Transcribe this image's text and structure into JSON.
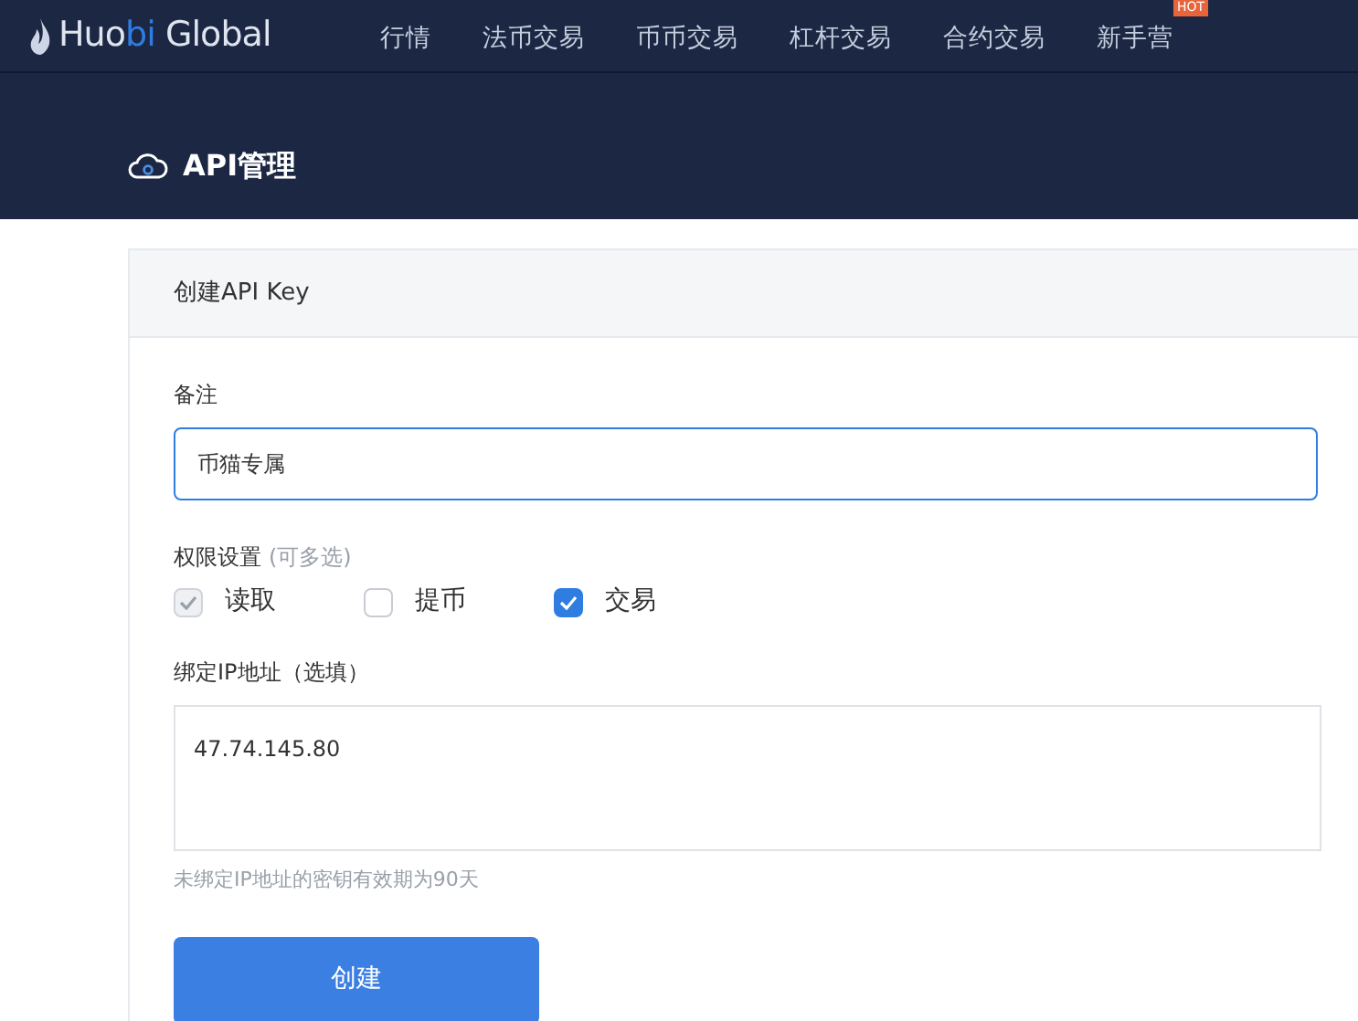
{
  "logo": {
    "before": "Huo",
    "accent": "bi",
    "after": " Global"
  },
  "nav": [
    {
      "label": "行情"
    },
    {
      "label": "法币交易"
    },
    {
      "label": "币币交易"
    },
    {
      "label": "杠杆交易"
    },
    {
      "label": "合约交易"
    },
    {
      "label": "新手营",
      "badge": "HOT"
    }
  ],
  "page_title": "API管理",
  "card": {
    "title": "创建API Key",
    "note": {
      "label": "备注",
      "value": "币猫专属"
    },
    "permissions": {
      "label": "权限设置",
      "hint": "(可多选)",
      "options": [
        {
          "label": "读取",
          "checked": true,
          "disabled": true
        },
        {
          "label": "提币",
          "checked": false,
          "disabled": false
        },
        {
          "label": "交易",
          "checked": true,
          "disabled": false
        }
      ]
    },
    "ip": {
      "label": "绑定IP地址（选填）",
      "value": "47.74.145.80",
      "help": "未绑定IP地址的密钥有效期为90天"
    },
    "submit": "创建"
  }
}
